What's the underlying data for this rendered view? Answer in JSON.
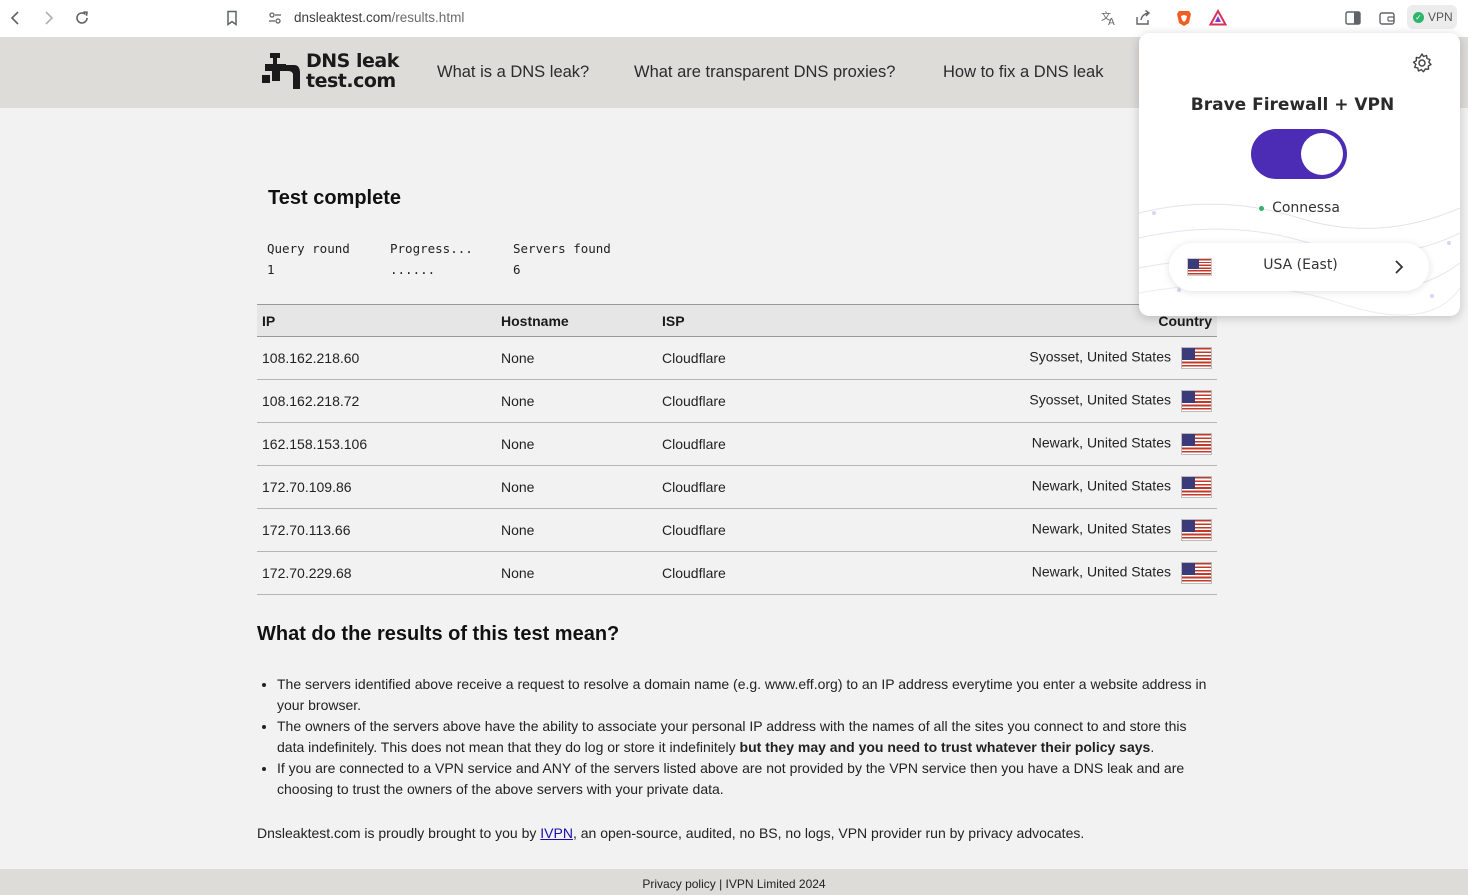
{
  "browser": {
    "url_host": "dnsleaktest.com",
    "url_path": "/results.html",
    "vpn_badge": "VPN"
  },
  "site": {
    "logo_line1": "DNS leak",
    "logo_line2": "test.com",
    "nav": [
      "What is a DNS leak?",
      "What are transparent DNS proxies?",
      "How to fix a DNS leak"
    ]
  },
  "test": {
    "title": "Test complete",
    "query_round_label": "Query round",
    "query_round_value": "1",
    "progress_label": "Progress...",
    "progress_value": "......",
    "servers_found_label": "Servers found",
    "servers_found_value": "6"
  },
  "table": {
    "headers": [
      "IP",
      "Hostname",
      "ISP",
      "Country"
    ],
    "rows": [
      {
        "ip": "108.162.218.60",
        "hostname": "None",
        "isp": "Cloudflare",
        "country": "Syosset, United States"
      },
      {
        "ip": "108.162.218.72",
        "hostname": "None",
        "isp": "Cloudflare",
        "country": "Syosset, United States"
      },
      {
        "ip": "162.158.153.106",
        "hostname": "None",
        "isp": "Cloudflare",
        "country": "Newark, United States"
      },
      {
        "ip": "172.70.109.86",
        "hostname": "None",
        "isp": "Cloudflare",
        "country": "Newark, United States"
      },
      {
        "ip": "172.70.113.66",
        "hostname": "None",
        "isp": "Cloudflare",
        "country": "Newark, United States"
      },
      {
        "ip": "172.70.229.68",
        "hostname": "None",
        "isp": "Cloudflare",
        "country": "Newark, United States"
      }
    ]
  },
  "explanation": {
    "title": "What do the results of this test mean?",
    "point1": "The servers identified above receive a request to resolve a domain name (e.g. www.eff.org) to an IP address everytime you enter a website address in your browser.",
    "point2_plain": "The owners of the servers above have the ability to associate your personal IP address with the names of all the sites you connect to and store this data indefinitely. This does not mean that they do log or store it indefinitely ",
    "point2_bold": "but they may and you need to trust whatever their policy says",
    "point2_end": ".",
    "point3": "If you are connected to a VPN service and ANY of the servers listed above are not provided by the VPN service then you have a DNS leak and are choosing to trust the owners of the above servers with your private data."
  },
  "footnote": {
    "before": "Dnsleaktest.com is proudly brought to you by ",
    "link": "IVPN",
    "after": ", an open-source, audited, no BS, no logs, VPN provider run by privacy advocates."
  },
  "footer": {
    "text": "Privacy policy | IVPN Limited 2024"
  },
  "vpn_popup": {
    "title": "Brave Firewall + VPN",
    "toggle_on": true,
    "status": "Connessa",
    "region": "USA (East)"
  },
  "colors": {
    "toggle": "#4c2bb5",
    "connected": "#2db56b",
    "header_bg": "#dedcd9"
  }
}
